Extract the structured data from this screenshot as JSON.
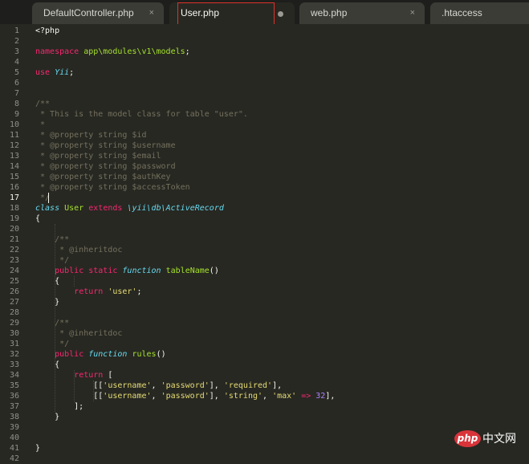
{
  "tabs": [
    {
      "label": "DefaultController.php",
      "close": "×"
    },
    {
      "label": "User.php",
      "modified": true
    },
    {
      "label": "web.php",
      "close": "×"
    },
    {
      "label": ".htaccess"
    }
  ],
  "active_line": 17,
  "code": [
    [
      {
        "t": "<?php",
        "c": "plain"
      }
    ],
    [],
    [
      {
        "t": "namespace",
        "c": "kw"
      },
      {
        "t": " app\\modules\\v1\\models",
        "c": "cls"
      },
      {
        "t": ";",
        "c": "plain"
      }
    ],
    [],
    [
      {
        "t": "use",
        "c": "kw"
      },
      {
        "t": " ",
        "c": "plain"
      },
      {
        "t": "Yii",
        "c": "st"
      },
      {
        "t": ";",
        "c": "plain"
      }
    ],
    [],
    [],
    [
      {
        "t": "/**",
        "c": "cm"
      }
    ],
    [
      {
        "t": " * This is the model class for table \"user\".",
        "c": "cm"
      }
    ],
    [
      {
        "t": " *",
        "c": "cm"
      }
    ],
    [
      {
        "t": " * @property string $id",
        "c": "cm"
      }
    ],
    [
      {
        "t": " * @property string $username",
        "c": "cm"
      }
    ],
    [
      {
        "t": " * @property string $email",
        "c": "cm"
      }
    ],
    [
      {
        "t": " * @property string $password",
        "c": "cm"
      }
    ],
    [
      {
        "t": " * @property string $authKey",
        "c": "cm"
      }
    ],
    [
      {
        "t": " * @property string $accessToken",
        "c": "cm"
      }
    ],
    [
      {
        "t": " */",
        "c": "cm"
      }
    ],
    [
      {
        "t": "class",
        "c": "st"
      },
      {
        "t": " ",
        "c": "plain"
      },
      {
        "t": "User",
        "c": "cls"
      },
      {
        "t": " ",
        "c": "plain"
      },
      {
        "t": "extends",
        "c": "kw"
      },
      {
        "t": " ",
        "c": "plain"
      },
      {
        "t": "\\yii\\db\\ActiveRecord",
        "c": "sp"
      },
      {
        "t": " ",
        "c": "plain"
      }
    ],
    [
      {
        "t": "{",
        "c": "plain"
      }
    ],
    [],
    [
      {
        "t": "    /**",
        "c": "cm"
      }
    ],
    [
      {
        "t": "     * @inheritdoc",
        "c": "cm"
      }
    ],
    [
      {
        "t": "     */",
        "c": "cm"
      }
    ],
    [
      {
        "t": "    ",
        "c": "plain"
      },
      {
        "t": "public",
        "c": "kw"
      },
      {
        "t": " ",
        "c": "plain"
      },
      {
        "t": "static",
        "c": "kw"
      },
      {
        "t": " ",
        "c": "plain"
      },
      {
        "t": "function",
        "c": "st"
      },
      {
        "t": " ",
        "c": "plain"
      },
      {
        "t": "tableName",
        "c": "fn"
      },
      {
        "t": "()",
        "c": "plain"
      }
    ],
    [
      {
        "t": "    {",
        "c": "plain"
      }
    ],
    [
      {
        "t": "        ",
        "c": "plain"
      },
      {
        "t": "return",
        "c": "kw"
      },
      {
        "t": " ",
        "c": "plain"
      },
      {
        "t": "'user'",
        "c": "str"
      },
      {
        "t": ";",
        "c": "plain"
      }
    ],
    [
      {
        "t": "    }",
        "c": "plain"
      }
    ],
    [],
    [
      {
        "t": "    /**",
        "c": "cm"
      }
    ],
    [
      {
        "t": "     * @inheritdoc",
        "c": "cm"
      }
    ],
    [
      {
        "t": "     */",
        "c": "cm"
      }
    ],
    [
      {
        "t": "    ",
        "c": "plain"
      },
      {
        "t": "public",
        "c": "kw"
      },
      {
        "t": " ",
        "c": "plain"
      },
      {
        "t": "function",
        "c": "st"
      },
      {
        "t": " ",
        "c": "plain"
      },
      {
        "t": "rules",
        "c": "fn"
      },
      {
        "t": "()",
        "c": "plain"
      }
    ],
    [
      {
        "t": "    {",
        "c": "plain"
      }
    ],
    [
      {
        "t": "        ",
        "c": "plain"
      },
      {
        "t": "return",
        "c": "kw"
      },
      {
        "t": " [",
        "c": "plain"
      }
    ],
    [
      {
        "t": "            [[",
        "c": "plain"
      },
      {
        "t": "'username'",
        "c": "str"
      },
      {
        "t": ", ",
        "c": "plain"
      },
      {
        "t": "'password'",
        "c": "str"
      },
      {
        "t": "], ",
        "c": "plain"
      },
      {
        "t": "'required'",
        "c": "str"
      },
      {
        "t": "],",
        "c": "plain"
      }
    ],
    [
      {
        "t": "            [[",
        "c": "plain"
      },
      {
        "t": "'username'",
        "c": "str"
      },
      {
        "t": ", ",
        "c": "plain"
      },
      {
        "t": "'password'",
        "c": "str"
      },
      {
        "t": "], ",
        "c": "plain"
      },
      {
        "t": "'string'",
        "c": "str"
      },
      {
        "t": ", ",
        "c": "plain"
      },
      {
        "t": "'max'",
        "c": "str"
      },
      {
        "t": " ",
        "c": "plain"
      },
      {
        "t": "=>",
        "c": "kw"
      },
      {
        "t": " ",
        "c": "plain"
      },
      {
        "t": "32",
        "c": "num"
      },
      {
        "t": "],",
        "c": "plain"
      }
    ],
    [
      {
        "t": "        ];",
        "c": "plain"
      }
    ],
    [
      {
        "t": "    }",
        "c": "plain"
      }
    ],
    [],
    [],
    [
      {
        "t": "}",
        "c": "plain"
      }
    ],
    []
  ],
  "watermark": {
    "logo": "php",
    "text": "中文网"
  }
}
